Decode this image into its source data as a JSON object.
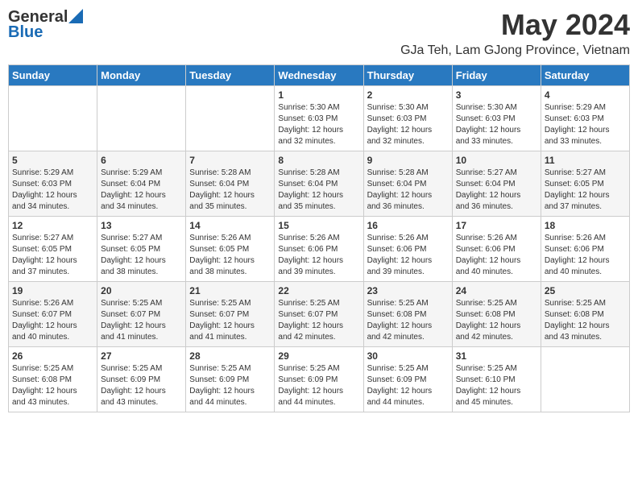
{
  "header": {
    "logo_general": "General",
    "logo_blue": "Blue",
    "title": "May 2024",
    "location": "GJa Teh, Lam GJong Province, Vietnam"
  },
  "days_of_week": [
    "Sunday",
    "Monday",
    "Tuesday",
    "Wednesday",
    "Thursday",
    "Friday",
    "Saturday"
  ],
  "weeks": [
    {
      "days": [
        {
          "num": "",
          "info": ""
        },
        {
          "num": "",
          "info": ""
        },
        {
          "num": "",
          "info": ""
        },
        {
          "num": "1",
          "info": "Sunrise: 5:30 AM\nSunset: 6:03 PM\nDaylight: 12 hours\nand 32 minutes."
        },
        {
          "num": "2",
          "info": "Sunrise: 5:30 AM\nSunset: 6:03 PM\nDaylight: 12 hours\nand 32 minutes."
        },
        {
          "num": "3",
          "info": "Sunrise: 5:30 AM\nSunset: 6:03 PM\nDaylight: 12 hours\nand 33 minutes."
        },
        {
          "num": "4",
          "info": "Sunrise: 5:29 AM\nSunset: 6:03 PM\nDaylight: 12 hours\nand 33 minutes."
        }
      ]
    },
    {
      "days": [
        {
          "num": "5",
          "info": "Sunrise: 5:29 AM\nSunset: 6:03 PM\nDaylight: 12 hours\nand 34 minutes."
        },
        {
          "num": "6",
          "info": "Sunrise: 5:29 AM\nSunset: 6:04 PM\nDaylight: 12 hours\nand 34 minutes."
        },
        {
          "num": "7",
          "info": "Sunrise: 5:28 AM\nSunset: 6:04 PM\nDaylight: 12 hours\nand 35 minutes."
        },
        {
          "num": "8",
          "info": "Sunrise: 5:28 AM\nSunset: 6:04 PM\nDaylight: 12 hours\nand 35 minutes."
        },
        {
          "num": "9",
          "info": "Sunrise: 5:28 AM\nSunset: 6:04 PM\nDaylight: 12 hours\nand 36 minutes."
        },
        {
          "num": "10",
          "info": "Sunrise: 5:27 AM\nSunset: 6:04 PM\nDaylight: 12 hours\nand 36 minutes."
        },
        {
          "num": "11",
          "info": "Sunrise: 5:27 AM\nSunset: 6:05 PM\nDaylight: 12 hours\nand 37 minutes."
        }
      ]
    },
    {
      "days": [
        {
          "num": "12",
          "info": "Sunrise: 5:27 AM\nSunset: 6:05 PM\nDaylight: 12 hours\nand 37 minutes."
        },
        {
          "num": "13",
          "info": "Sunrise: 5:27 AM\nSunset: 6:05 PM\nDaylight: 12 hours\nand 38 minutes."
        },
        {
          "num": "14",
          "info": "Sunrise: 5:26 AM\nSunset: 6:05 PM\nDaylight: 12 hours\nand 38 minutes."
        },
        {
          "num": "15",
          "info": "Sunrise: 5:26 AM\nSunset: 6:06 PM\nDaylight: 12 hours\nand 39 minutes."
        },
        {
          "num": "16",
          "info": "Sunrise: 5:26 AM\nSunset: 6:06 PM\nDaylight: 12 hours\nand 39 minutes."
        },
        {
          "num": "17",
          "info": "Sunrise: 5:26 AM\nSunset: 6:06 PM\nDaylight: 12 hours\nand 40 minutes."
        },
        {
          "num": "18",
          "info": "Sunrise: 5:26 AM\nSunset: 6:06 PM\nDaylight: 12 hours\nand 40 minutes."
        }
      ]
    },
    {
      "days": [
        {
          "num": "19",
          "info": "Sunrise: 5:26 AM\nSunset: 6:07 PM\nDaylight: 12 hours\nand 40 minutes."
        },
        {
          "num": "20",
          "info": "Sunrise: 5:25 AM\nSunset: 6:07 PM\nDaylight: 12 hours\nand 41 minutes."
        },
        {
          "num": "21",
          "info": "Sunrise: 5:25 AM\nSunset: 6:07 PM\nDaylight: 12 hours\nand 41 minutes."
        },
        {
          "num": "22",
          "info": "Sunrise: 5:25 AM\nSunset: 6:07 PM\nDaylight: 12 hours\nand 42 minutes."
        },
        {
          "num": "23",
          "info": "Sunrise: 5:25 AM\nSunset: 6:08 PM\nDaylight: 12 hours\nand 42 minutes."
        },
        {
          "num": "24",
          "info": "Sunrise: 5:25 AM\nSunset: 6:08 PM\nDaylight: 12 hours\nand 42 minutes."
        },
        {
          "num": "25",
          "info": "Sunrise: 5:25 AM\nSunset: 6:08 PM\nDaylight: 12 hours\nand 43 minutes."
        }
      ]
    },
    {
      "days": [
        {
          "num": "26",
          "info": "Sunrise: 5:25 AM\nSunset: 6:08 PM\nDaylight: 12 hours\nand 43 minutes."
        },
        {
          "num": "27",
          "info": "Sunrise: 5:25 AM\nSunset: 6:09 PM\nDaylight: 12 hours\nand 43 minutes."
        },
        {
          "num": "28",
          "info": "Sunrise: 5:25 AM\nSunset: 6:09 PM\nDaylight: 12 hours\nand 44 minutes."
        },
        {
          "num": "29",
          "info": "Sunrise: 5:25 AM\nSunset: 6:09 PM\nDaylight: 12 hours\nand 44 minutes."
        },
        {
          "num": "30",
          "info": "Sunrise: 5:25 AM\nSunset: 6:09 PM\nDaylight: 12 hours\nand 44 minutes."
        },
        {
          "num": "31",
          "info": "Sunrise: 5:25 AM\nSunset: 6:10 PM\nDaylight: 12 hours\nand 45 minutes."
        },
        {
          "num": "",
          "info": ""
        }
      ]
    }
  ]
}
